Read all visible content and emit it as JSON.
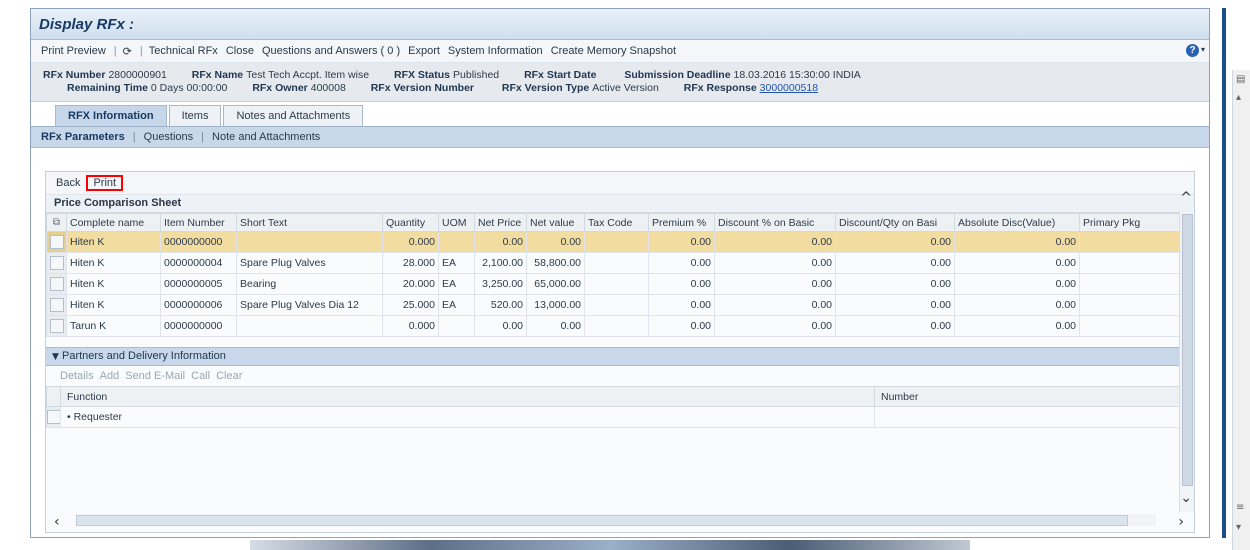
{
  "window": {
    "title": "Display RFx :"
  },
  "menu": {
    "print_preview": "Print Preview",
    "technical_rfx": "Technical RFx",
    "close": "Close",
    "questions_answers": "Questions and Answers ( 0 )",
    "export": "Export",
    "system_information": "System Information",
    "create_memory_snapshot": "Create Memory Snapshot"
  },
  "header": {
    "rfx_number_label": "RFx Number",
    "rfx_number": "2800000901",
    "rfx_name_label": "RFx Name",
    "rfx_name": "Test Tech Accpt. Item wise",
    "rfx_status_label": "RFX Status",
    "rfx_status": "Published",
    "rfx_start_date_label": "RFx Start Date",
    "submission_deadline_label": "Submission Deadline",
    "submission_deadline": "18.03.2016 15:30:00 INDIA",
    "remaining_time_label": "Remaining Time",
    "remaining_time": "0 Days 00:00:00",
    "rfx_owner_label": "RFx Owner",
    "rfx_owner": "400008",
    "rfx_version_number_label": "RFx Version Number",
    "rfx_version_type_label": "RFx Version Type",
    "rfx_version_type": "Active Version",
    "rfx_response_label": "RFx Response",
    "rfx_response": "3000000518"
  },
  "tabs": [
    "RFX Information",
    "Items",
    "Notes and Attachments"
  ],
  "subtabs": [
    "RFx Parameters",
    "Questions",
    "Note and Attachments"
  ],
  "toolbar": {
    "back": "Back",
    "print": "Print"
  },
  "price_sheet": {
    "title": "Price Comparison Sheet",
    "columns": [
      "Complete name",
      "Item Number",
      "Short Text",
      "Quantity",
      "UOM",
      "Net Price",
      "Net value",
      "Tax Code",
      "Premium %",
      "Discount % on Basic",
      "Discount/Qty on Basi",
      "Absolute Disc(Value)",
      "Primary Pkg"
    ],
    "rows": [
      {
        "name": "Hiten K",
        "item": "0000000000",
        "text": "",
        "qty": "0.000",
        "uom": "",
        "net_price": "0.00",
        "net_value": "0.00",
        "tax": "",
        "premium": "0.00",
        "disc_basic": "0.00",
        "disc_qty": "0.00",
        "abs_disc": "0.00"
      },
      {
        "name": "Hiten K",
        "item": "0000000004",
        "text": "Spare Plug Valves",
        "qty": "28.000",
        "uom": "EA",
        "net_price": "2,100.00",
        "net_value": "58,800.00",
        "tax": "",
        "premium": "0.00",
        "disc_basic": "0.00",
        "disc_qty": "0.00",
        "abs_disc": "0.00"
      },
      {
        "name": "Hiten K",
        "item": "0000000005",
        "text": "Bearing",
        "qty": "20.000",
        "uom": "EA",
        "net_price": "3,250.00",
        "net_value": "65,000.00",
        "tax": "",
        "premium": "0.00",
        "disc_basic": "0.00",
        "disc_qty": "0.00",
        "abs_disc": "0.00"
      },
      {
        "name": "Hiten K",
        "item": "0000000006",
        "text": "Spare Plug Valves Dia 12",
        "qty": "25.000",
        "uom": "EA",
        "net_price": "520.00",
        "net_value": "13,000.00",
        "tax": "",
        "premium": "0.00",
        "disc_basic": "0.00",
        "disc_qty": "0.00",
        "abs_disc": "0.00"
      },
      {
        "name": "Tarun K",
        "item": "0000000000",
        "text": "",
        "qty": "0.000",
        "uom": "",
        "net_price": "0.00",
        "net_value": "0.00",
        "tax": "",
        "premium": "0.00",
        "disc_basic": "0.00",
        "disc_qty": "0.00",
        "abs_disc": "0.00"
      }
    ]
  },
  "partners": {
    "title": "Partners and Delivery Information",
    "tools": {
      "details": "Details",
      "add": "Add",
      "send_email": "Send E-Mail",
      "call": "Call",
      "clear": "Clear"
    },
    "columns": {
      "function": "Function",
      "number": "Number"
    },
    "rows": [
      {
        "function": "Requester",
        "number": ""
      }
    ]
  },
  "icons": {
    "help": "help-icon",
    "refresh": "refresh-icon"
  }
}
